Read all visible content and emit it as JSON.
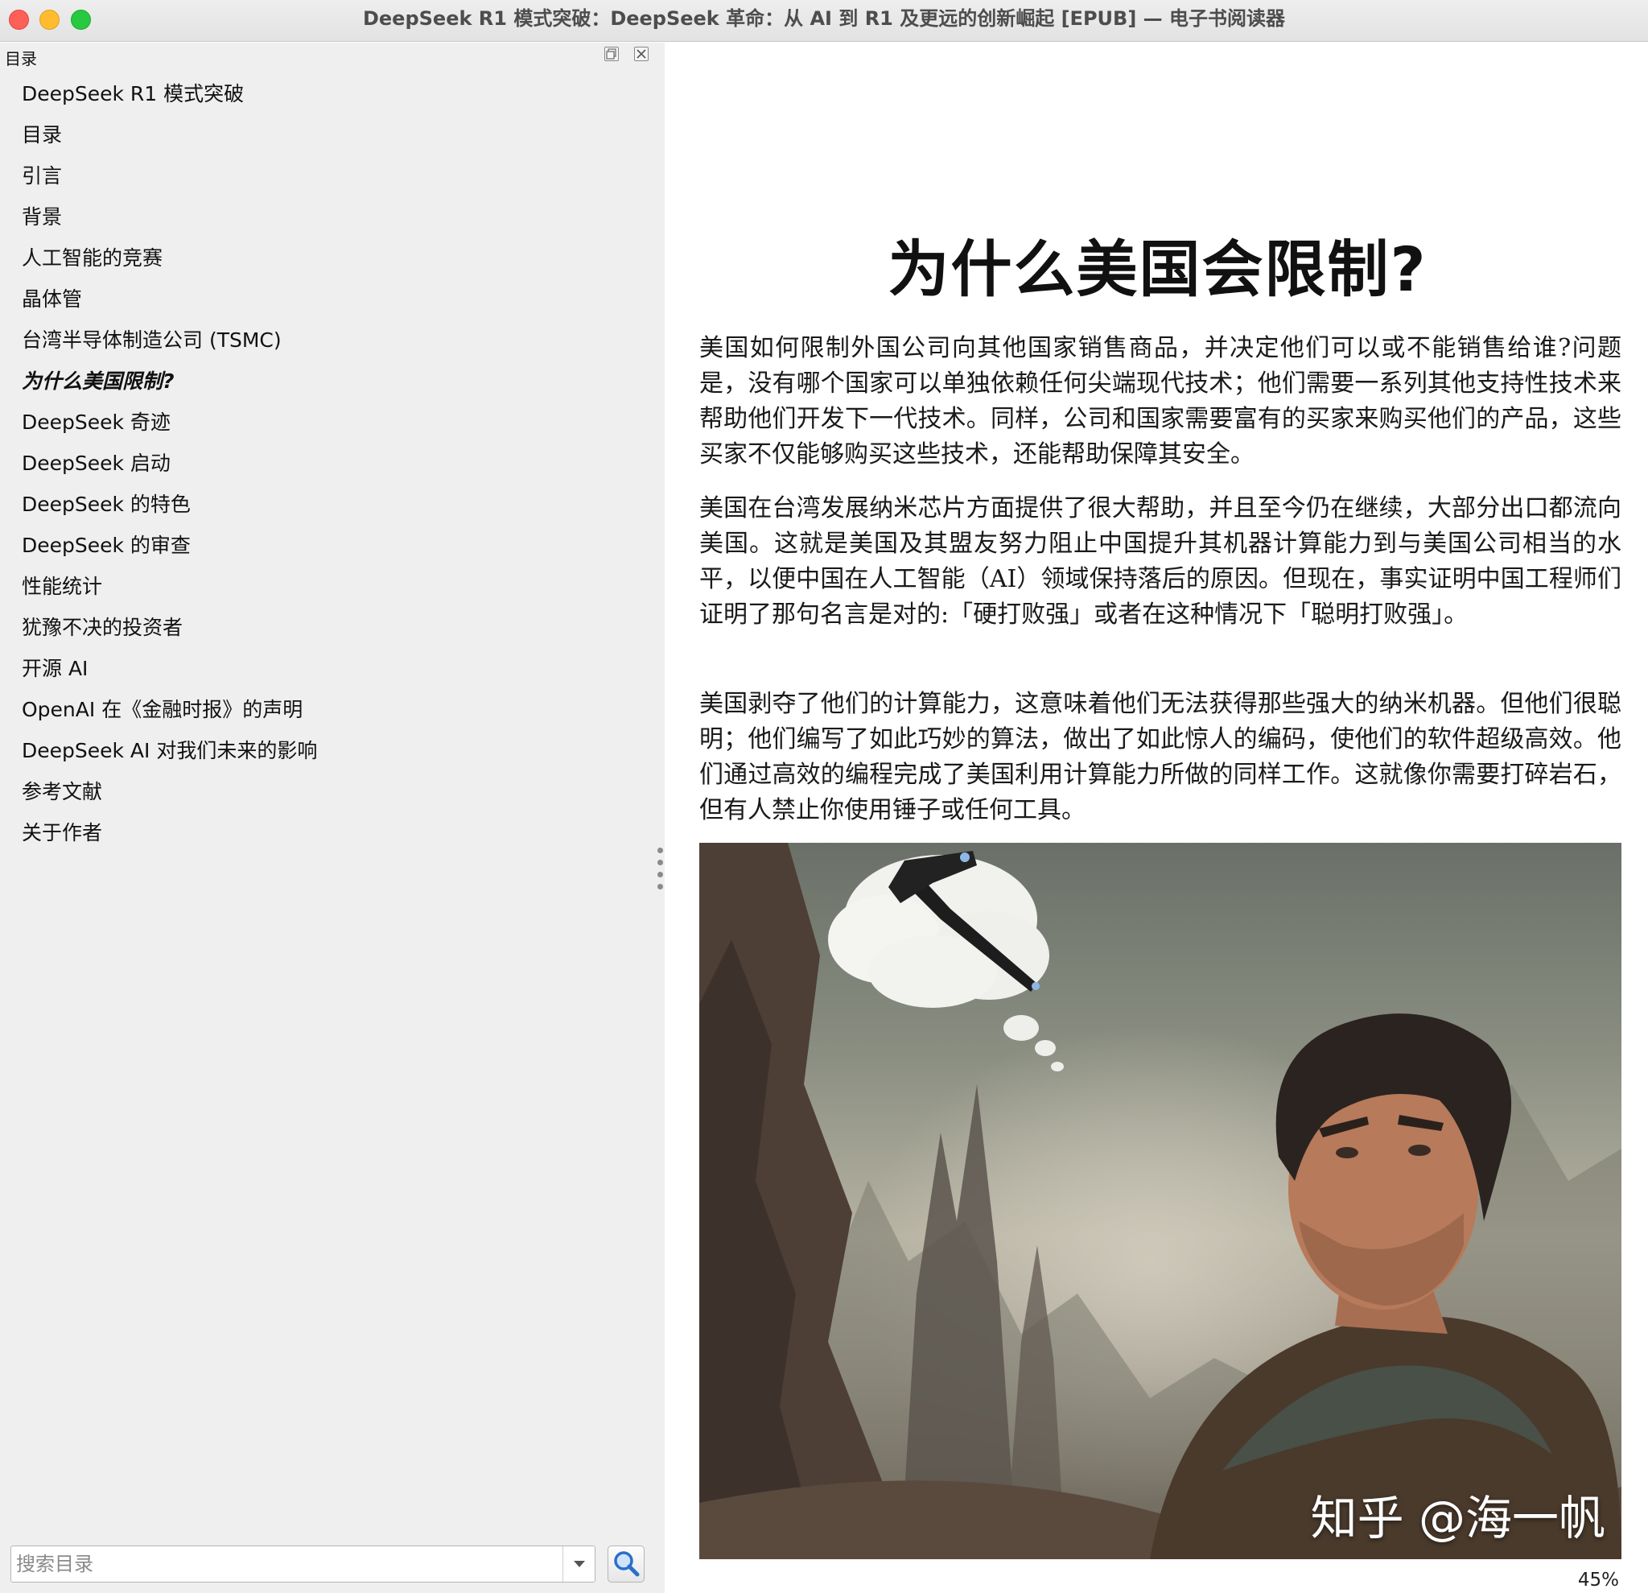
{
  "window": {
    "title": "DeepSeek R1 模式突破：DeepSeek 革命：从 AI 到 R1 及更远的创新崛起 [EPUB] — 电子书阅读器"
  },
  "toc": {
    "header": "目录",
    "items": [
      "DeepSeek R1 模式突破",
      "目录",
      "引言",
      "背景",
      "人工智能的竞赛",
      "晶体管",
      "台湾半导体制造公司 (TSMC)",
      "为什么美国限制?",
      "DeepSeek 奇迹",
      "DeepSeek 启动",
      "DeepSeek 的特色",
      "DeepSeek 的审查",
      "性能统计",
      "犹豫不决的投资者",
      "开源 AI",
      "OpenAI 在《金融时报》的声明",
      "DeepSeek AI 对我们未来的影响",
      "参考文献",
      "关于作者"
    ],
    "current_index": 7,
    "search_placeholder": "搜索目录"
  },
  "reader": {
    "chapter_title": "为什么美国会限制?",
    "paragraphs": [
      "美国如何限制外国公司向其他国家销售商品，并决定他们可以或不能销售给谁?问题是，没有哪个国家可以单独依赖任何尖端现代技术；他们需要一系列其他支持性技术来帮助他们开发下一代技术。同样，公司和国家需要富有的买家来购买他们的产品，这些买家不仅能够购买这些技术，还能帮助保障其安全。",
      "美国在台湾发展纳米芯片方面提供了很大帮助，并且至今仍在继续，大部分出口都流向美国。这就是美国及其盟友努力阻止中国提升其机器计算能力到与美国公司相当的水平，以便中国在人工智能（AI）领域保持落后的原因。但现在，事实证明中国工程师们证明了那句名言是对的:「硬打败强」或者在这种情况下「聪明打败强」。",
      "美国剥夺了他们的计算能力，这意味着他们无法获得那些强大的纳米机器。但他们很聪明；他们编写了如此巧妙的算法，做出了如此惊人的编码，使他们的软件超级高效。他们通过高效的编程完成了美国利用计算能力所做的同样工作。这就像你需要打碎岩石，但有人禁止你使用锤子或任何工具。"
    ],
    "illustration_watermark": "知乎 @海一帆",
    "progress": "45%"
  }
}
